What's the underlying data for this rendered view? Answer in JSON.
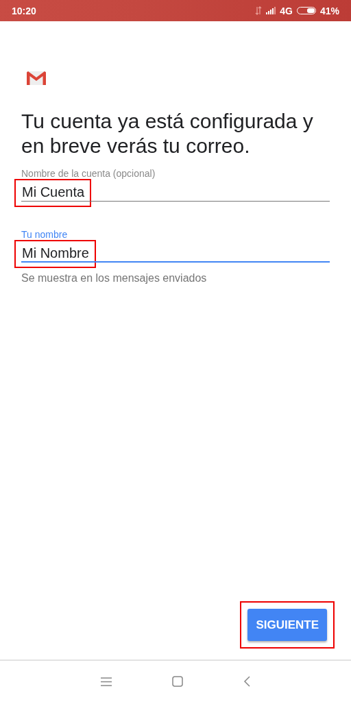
{
  "status_bar": {
    "time": "10:20",
    "network": "4G",
    "battery": "41%"
  },
  "title": "Tu cuenta ya está configurada y en breve verás tu correo.",
  "fields": [
    {
      "label": "Nombre de la cuenta (opcional)",
      "value": "Mi Cuenta",
      "focused": false,
      "highlighted": true
    },
    {
      "label": "Tu nombre",
      "value": "Mi Nombre",
      "focused": true,
      "highlighted": true,
      "helper": "Se muestra en los mensajes enviados"
    }
  ],
  "next_button": {
    "label": "SIGUIENTE",
    "highlighted": true
  }
}
